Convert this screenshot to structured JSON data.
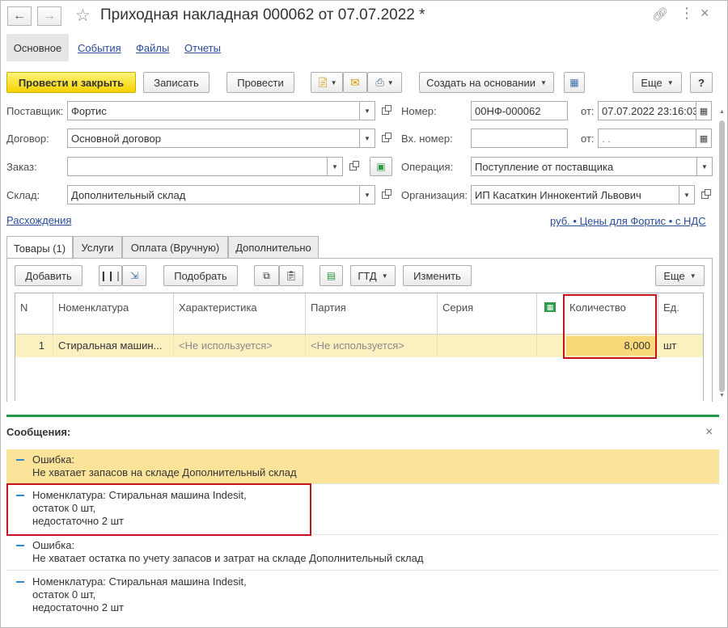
{
  "window": {
    "title": "Приходная накладная 000062 от 07.07.2022 *"
  },
  "sections": {
    "main": "Основное",
    "events": "События",
    "files": "Файлы",
    "reports": "Отчеты"
  },
  "toolbar": {
    "post_close": "Провести и закрыть",
    "save": "Записать",
    "post": "Провести",
    "create_based": "Создать на основании",
    "more": "Еще",
    "help": "?"
  },
  "form": {
    "supplier_label": "Поставщик:",
    "supplier_value": "Фортис",
    "contract_label": "Договор:",
    "contract_value": "Основной договор",
    "order_label": "Заказ:",
    "order_value": "",
    "warehouse_label": "Склад:",
    "warehouse_value": "Дополнительный склад",
    "number_label": "Номер:",
    "number_value": "00НФ-000062",
    "date_label": "от:",
    "date_value": "07.07.2022 23:16:03",
    "in_number_label": "Вх. номер:",
    "in_number_value": "",
    "in_date_label": "от:",
    "in_date_value": " .  .",
    "operation_label": "Операция:",
    "operation_value": "Поступление от поставщика",
    "org_label": "Организация:",
    "org_value": "ИП Касаткин Иннокентий Львович",
    "discrepancies_link": "Расхождения",
    "prices_link": "руб. • Цены для Фортис • с НДС"
  },
  "tabs": {
    "goods": "Товары (1)",
    "services": "Услуги",
    "payment": "Оплата (Вручную)",
    "additional": "Дополнительно"
  },
  "table_toolbar": {
    "add": "Добавить",
    "pick": "Подобрать",
    "gtd": "ГТД",
    "change": "Изменить",
    "more": "Еще"
  },
  "table": {
    "headers": {
      "n": "N",
      "nomenclature": "Номенклатура",
      "characteristic": "Характеристика",
      "batch": "Партия",
      "series": "Серия",
      "quantity": "Количество",
      "unit": "Ед."
    },
    "rows": [
      {
        "n": "1",
        "nomenclature": "Стиральная машин...",
        "characteristic": "<Не используется>",
        "batch": "<Не используется>",
        "series": "",
        "quantity": "8,000",
        "unit": "шт"
      }
    ]
  },
  "messages": {
    "title": "Сообщения:",
    "items": [
      {
        "line1": "Ошибка:",
        "line2": "Не хватает запасов на складе Дополнительный склад",
        "line3": ""
      },
      {
        "line1": "Номенклатура: Стиральная машина Indesit,",
        "line2": "остаток 0 шт,",
        "line3": "недостаточно 2 шт"
      },
      {
        "line1": "Ошибка:",
        "line2": "Не хватает остатка по учету запасов и затрат на складе Дополнительный склад",
        "line3": ""
      },
      {
        "line1": "Номенклатура: Стиральная машина Indesit,",
        "line2": "остаток 0 шт,",
        "line3": "недостаточно 2 шт"
      }
    ]
  },
  "icons": {
    "back": "arrow-left-icon",
    "forward": "arrow-right-icon",
    "favorite": "star-icon",
    "link": "link-icon",
    "more": "kebab-icon",
    "close": "close-icon"
  },
  "colors": {
    "primary_button": "#f4d200",
    "selected_row": "#fbf0c0",
    "error_message": "#fbe49a",
    "highlight_frame": "#c8121b",
    "messages_separator": "#1e9a4a",
    "link": "#2a4c9a"
  }
}
